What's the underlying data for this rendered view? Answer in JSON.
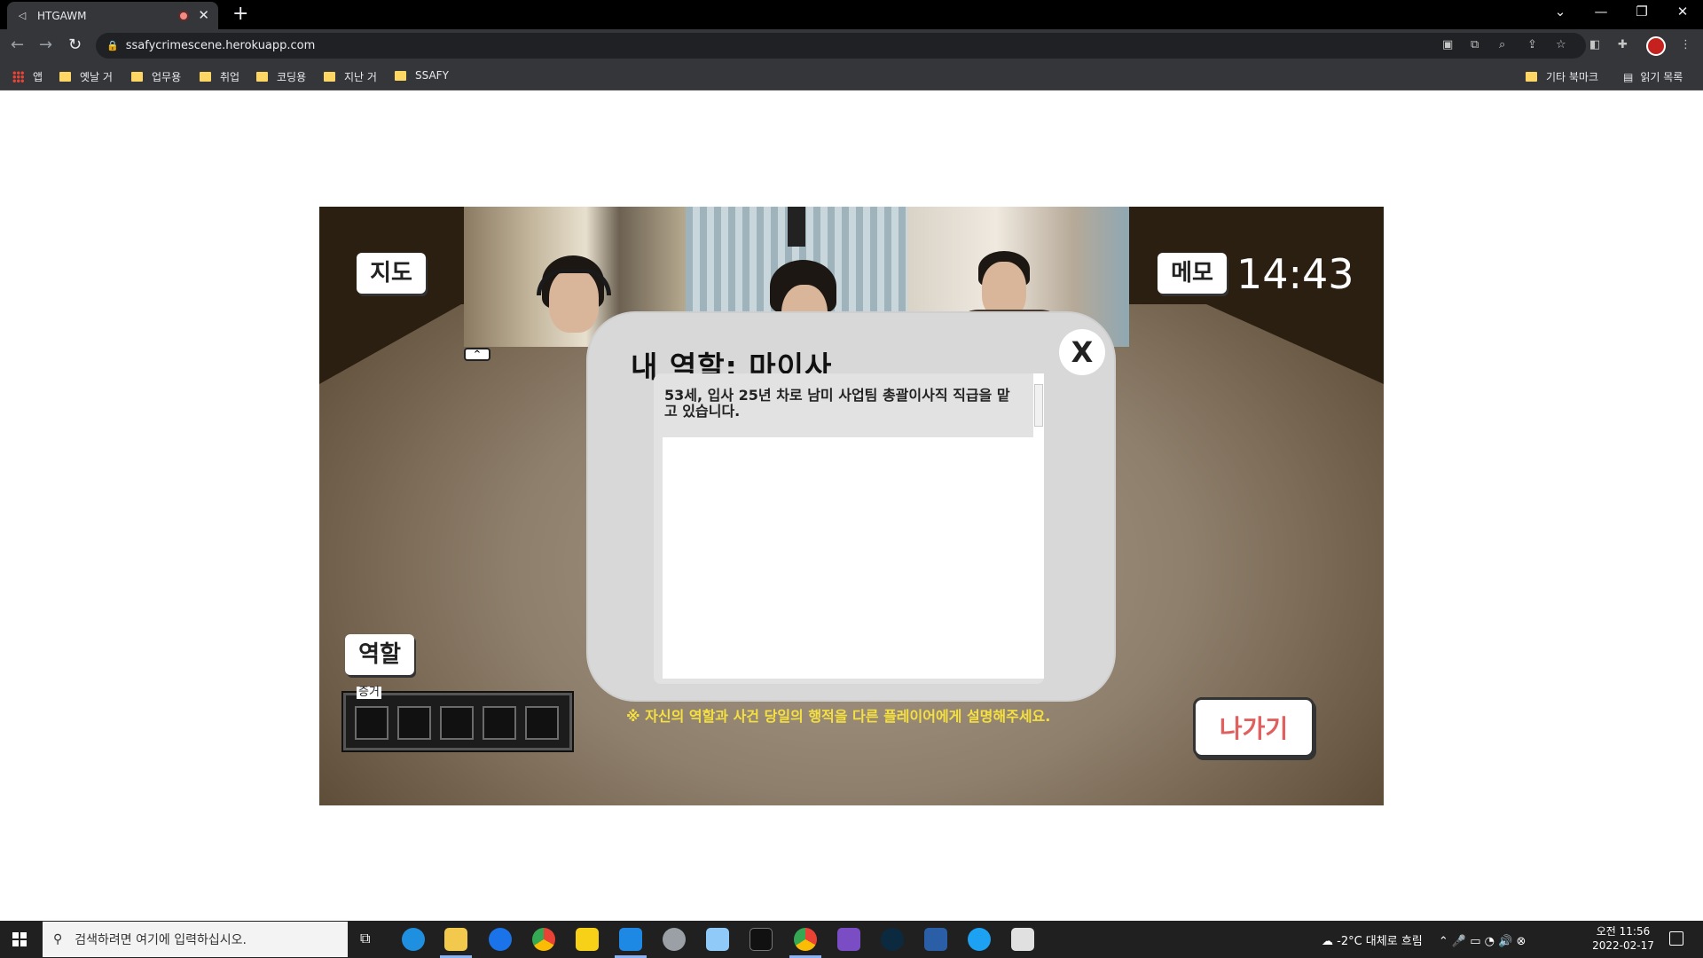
{
  "browser": {
    "tab_title": "HTGAWM",
    "new_tab_label": "+",
    "url": "ssafycrimescene.herokuapp.com",
    "bookmarks": [
      "앱",
      "옛날 거",
      "업무용",
      "취업",
      "코딩용",
      "지난 거",
      "SSAFY"
    ],
    "bookmarks_right": [
      "기타 북마크",
      "읽기 목록"
    ]
  },
  "game": {
    "map_button": "지도",
    "memo_button": "메모",
    "timer": "14:43",
    "role_button": "역할",
    "exit_button": "나가기",
    "video_toggle": "^",
    "evidence_label": "증거",
    "evidence_slots": 5
  },
  "modal": {
    "title": "내 역할:  마이사",
    "close_label": "X",
    "description": "53세, 입사 25년 차로 남미 사업팀 총괄이사직 직급을 맡고 있습니다.",
    "hint": "※ 자신의 역할과 사건 당일의 행적을 다른 플레이어에게 설명해주세요."
  },
  "taskbar": {
    "search_placeholder": "검색하려면 여기에 입력하십시오.",
    "weather": "-2°C  대체로 흐림",
    "time": "오전 11:56",
    "date": "2022-02-17"
  }
}
